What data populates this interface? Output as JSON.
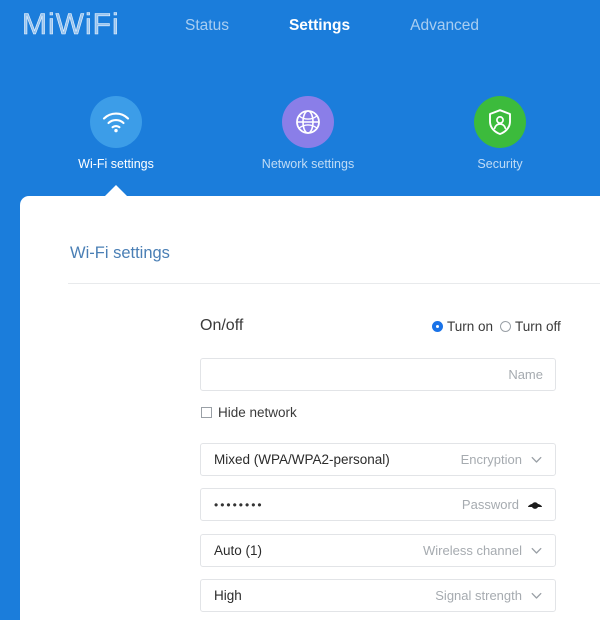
{
  "brand": {
    "logo": "MiWiFi"
  },
  "nav": {
    "items": [
      {
        "label": "Status",
        "active": false
      },
      {
        "label": "Settings",
        "active": true
      },
      {
        "label": "Advanced",
        "active": false
      }
    ]
  },
  "sections": {
    "items": [
      {
        "label": "Wi-Fi settings",
        "icon": "wifi-icon",
        "color": "#3c9de8",
        "active": true
      },
      {
        "label": "Network settings",
        "icon": "globe-icon",
        "color": "#8a7ee8",
        "active": false
      },
      {
        "label": "Security",
        "icon": "shield-user-icon",
        "color": "#3cbb3c",
        "active": false
      }
    ]
  },
  "panel": {
    "title": "Wi-Fi settings",
    "onoff": {
      "label": "On/off",
      "options": [
        {
          "label": "Turn on",
          "selected": true
        },
        {
          "label": "Turn off",
          "selected": false
        }
      ]
    },
    "name_field": {
      "value": "",
      "placeholder": "",
      "hint": "Name"
    },
    "hide_network": {
      "label": "Hide network",
      "checked": false
    },
    "encryption": {
      "value": "Mixed (WPA/WPA2-personal)",
      "hint": "Encryption"
    },
    "password": {
      "value": "••••••••",
      "hint": "Password"
    },
    "wireless_channel": {
      "value": "Auto (1)",
      "hint": "Wireless channel"
    },
    "signal_strength": {
      "value": "High",
      "hint": "Signal strength"
    }
  },
  "colors": {
    "background_blue": "#1b7ddb",
    "accent_blue": "#1a73e8",
    "title_blue": "#4a7fb5",
    "wifi_circle": "#3c9de8",
    "network_circle": "#8a7ee8",
    "security_circle": "#3cbb3c"
  }
}
